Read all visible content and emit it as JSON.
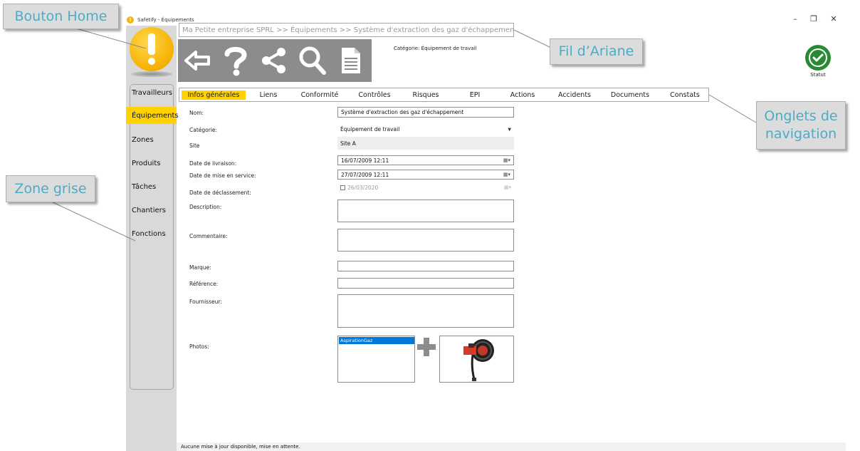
{
  "window": {
    "title": "Safetify - Équipements",
    "minimize": "–",
    "restore": "❐",
    "close": "✕"
  },
  "breadcrumb": "Ma Petite entreprise SPRL >> Équipements >> Système d'extraction des gaz d'échappement",
  "header": {
    "categorie": "Catégorie: Équipement de travail",
    "status_label": "Statut"
  },
  "nav": {
    "items": [
      {
        "label": "Travailleurs"
      },
      {
        "label": "Équipements"
      },
      {
        "label": "Zones"
      },
      {
        "label": "Produits"
      },
      {
        "label": "Tâches"
      },
      {
        "label": "Chantiers"
      },
      {
        "label": "Fonctions"
      }
    ],
    "active": "Équipements"
  },
  "toolbar": {
    "icons": [
      "back-arrow-icon",
      "help-icon",
      "share-icon",
      "search-icon",
      "document-icon"
    ]
  },
  "tabs": [
    {
      "label": "Infos générales"
    },
    {
      "label": "Liens"
    },
    {
      "label": "Conformité"
    },
    {
      "label": "Contrôles"
    },
    {
      "label": "Risques"
    },
    {
      "label": "EPI"
    },
    {
      "label": "Actions"
    },
    {
      "label": "Accidents"
    },
    {
      "label": "Documents"
    },
    {
      "label": "Constats"
    }
  ],
  "form": {
    "nom": {
      "label": "Nom:",
      "value": "Système d'extraction des gaz d'échappement"
    },
    "categorie": {
      "label": "Catégorie:",
      "value": "Équipement de travail"
    },
    "site": {
      "label": "Site",
      "value": "Site A"
    },
    "date_livraison": {
      "label": "Date de livraison:",
      "value": "16/07/2009 12:11"
    },
    "date_service": {
      "label": "Date de mise en service:",
      "value": "27/07/2009 12:11"
    },
    "date_declassement": {
      "label": "Date de déclassement:",
      "value": "26/03/2020"
    },
    "description": {
      "label": "Description:",
      "value": ""
    },
    "commentaire": {
      "label": "Commentaire:",
      "value": ""
    },
    "marque": {
      "label": "Marque:",
      "value": ""
    },
    "reference": {
      "label": "Référence:",
      "value": ""
    },
    "fournisseur": {
      "label": "Fournisseur:",
      "value": ""
    },
    "photos": {
      "label": "Photos:",
      "items": [
        "AspirationGaz"
      ]
    }
  },
  "status_bar": "Aucune mise à jour disponible, mise en attente.",
  "callouts": {
    "home": "Bouton Home",
    "breadcrumb": "Fil d’Ariane",
    "tabs": "Onglets de navigation",
    "grey_zone": "Zone grise"
  },
  "colors": {
    "accent_yellow": "#ffd200",
    "toolbar_grey": "#8c8c8c",
    "panel_grey": "#d9d9d9",
    "status_green": "#2a8a34",
    "callout_text": "#4bacc6"
  }
}
